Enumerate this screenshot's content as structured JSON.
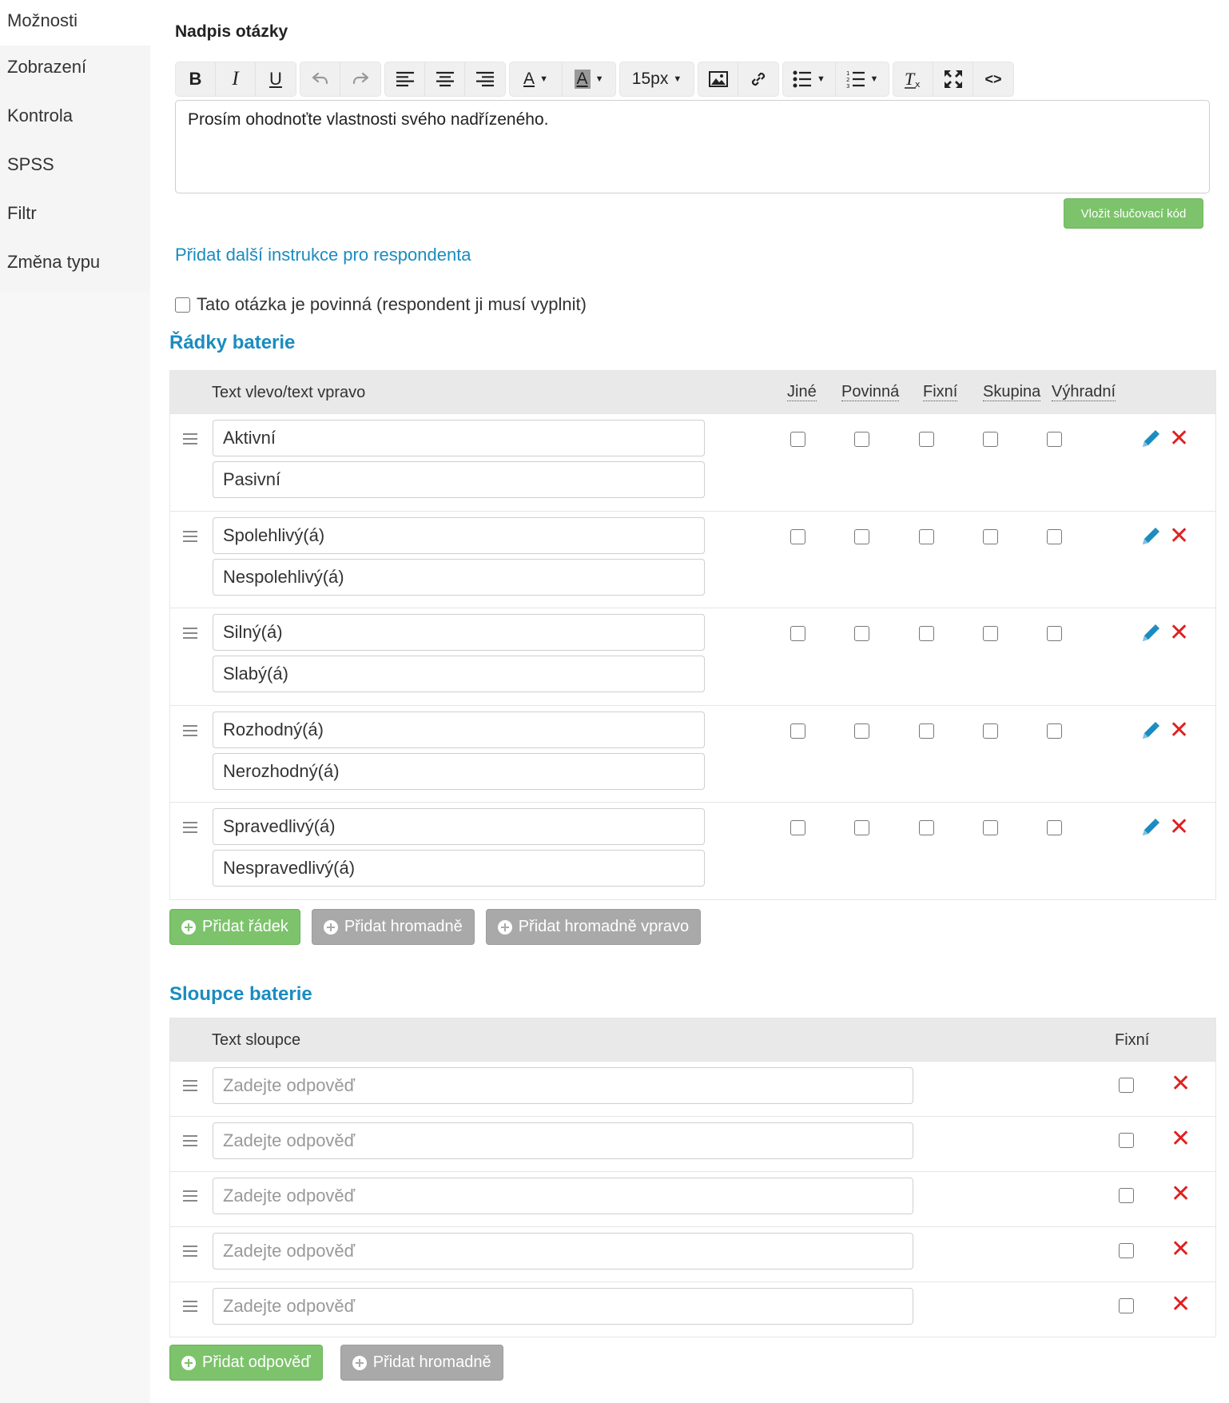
{
  "sidebar": {
    "items": [
      {
        "label": "Možnosti"
      },
      {
        "label": "Zobrazení"
      },
      {
        "label": "Kontrola"
      },
      {
        "label": "SPSS"
      },
      {
        "label": "Filtr"
      },
      {
        "label": "Změna typu"
      }
    ]
  },
  "question": {
    "label": "Nadpis otázky",
    "editor_text": "Prosím ohodnoťte vlastnosti svého nadřízeného.",
    "font_size": "15px",
    "merge_button": "Vložit slučovací kód",
    "instructions_link": "Přidat další instrukce pro respondenta",
    "required_label": "Tato otázka je povinná (respondent ji musí vyplnit)"
  },
  "toolbar": {
    "bold": "B",
    "italic": "I",
    "underline": "U",
    "text_color": "A",
    "bg_color": "A",
    "code": "<>"
  },
  "rows_section": {
    "title": "Řádky baterie",
    "headers": {
      "text": "Text vlevo/text vpravo",
      "other": "Jiné",
      "required": "Povinná",
      "fixed": "Fixní",
      "group": "Skupina",
      "exclusive": "Výhradní"
    },
    "rows": [
      {
        "left": "Aktivní",
        "right": "Pasivní"
      },
      {
        "left": "Spolehlivý(á)",
        "right": "Nespolehlivý(á)"
      },
      {
        "left": "Silný(á)",
        "right": "Slabý(á)"
      },
      {
        "left": "Rozhodný(á)",
        "right": "Nerozhodný(á)"
      },
      {
        "left": "Spravedlivý(á)",
        "right": "Nespravedlivý(á)"
      }
    ],
    "buttons": {
      "add_row": "Přidat řádek",
      "add_bulk": "Přidat hromadně",
      "add_bulk_right": "Přidat hromadně vpravo"
    }
  },
  "columns_section": {
    "title": "Sloupce baterie",
    "headers": {
      "text": "Text sloupce",
      "fixed": "Fixní"
    },
    "placeholder": "Zadejte odpověď",
    "rows": [
      {
        "value": ""
      },
      {
        "value": ""
      },
      {
        "value": ""
      },
      {
        "value": ""
      },
      {
        "value": ""
      }
    ],
    "buttons": {
      "add_answer": "Přidat odpověď",
      "add_bulk": "Přidat hromadně"
    }
  },
  "colors": {
    "accent": "#1a8cc0",
    "green_button": "#7cc36b",
    "gray_button": "#a9a9a9",
    "delete": "#e02020",
    "edit": "#1a8cc0"
  }
}
